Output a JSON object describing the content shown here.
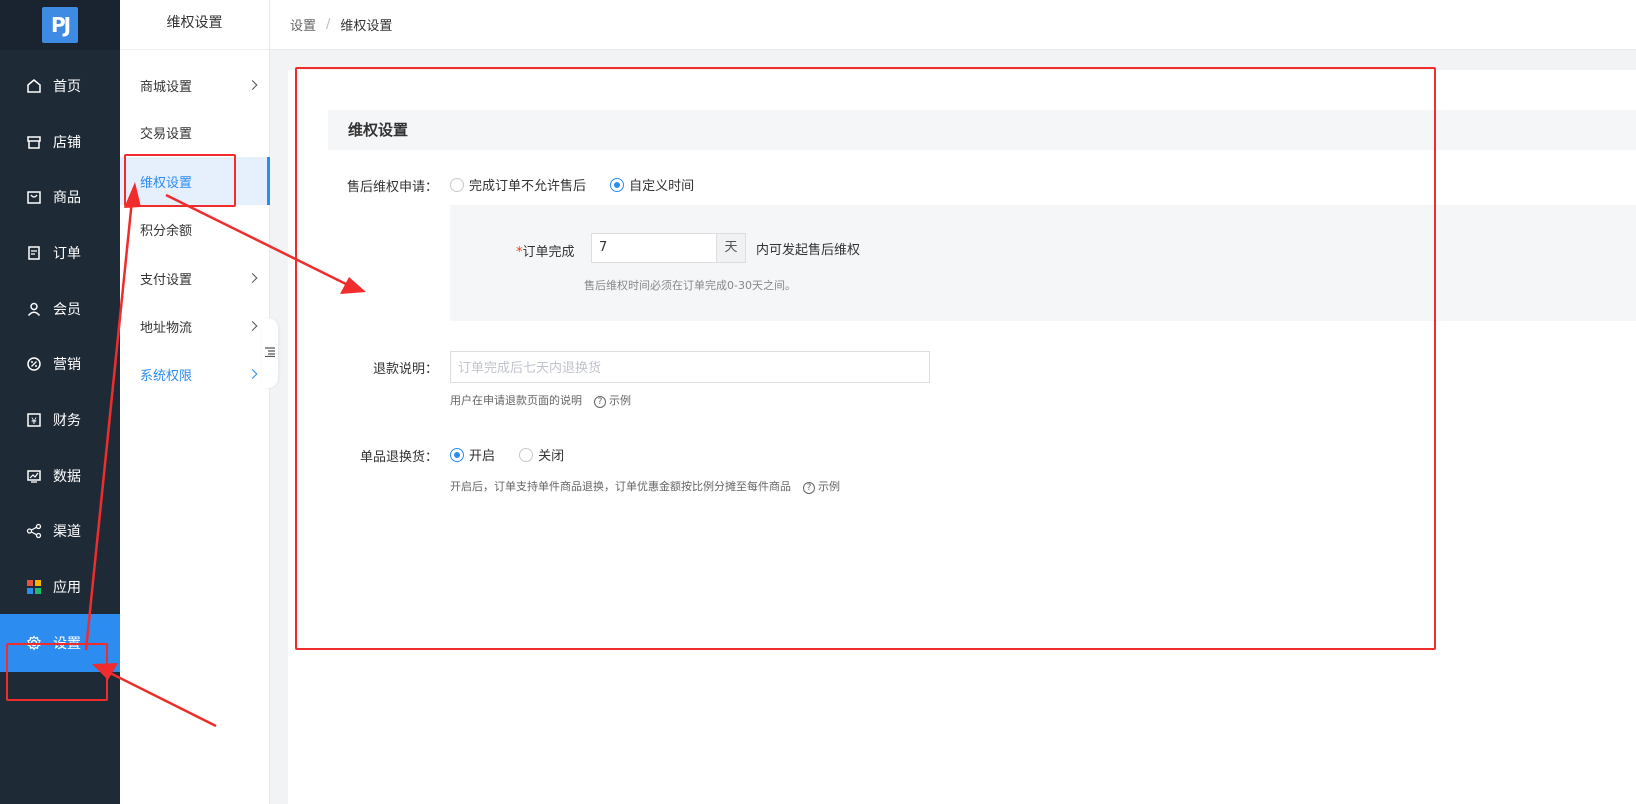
{
  "nav": {
    "logo_text": "PJ",
    "items": [
      {
        "label": "首页",
        "icon": "home-icon"
      },
      {
        "label": "店铺",
        "icon": "store-icon"
      },
      {
        "label": "商品",
        "icon": "bag-icon"
      },
      {
        "label": "订单",
        "icon": "order-icon"
      },
      {
        "label": "会员",
        "icon": "user-icon"
      },
      {
        "label": "营销",
        "icon": "marketing-icon"
      },
      {
        "label": "财务",
        "icon": "yen-icon"
      },
      {
        "label": "数据",
        "icon": "chart-icon"
      },
      {
        "label": "渠道",
        "icon": "share-icon"
      },
      {
        "label": "应用",
        "icon": "apps-icon"
      },
      {
        "label": "设置",
        "icon": "gear-icon"
      }
    ]
  },
  "subnav": {
    "title": "维权设置",
    "items": [
      {
        "label": "商城设置"
      },
      {
        "label": "交易设置"
      },
      {
        "label": "维权设置"
      },
      {
        "label": "积分余额"
      },
      {
        "label": "支付设置"
      },
      {
        "label": "地址物流"
      },
      {
        "label": "系统权限"
      }
    ]
  },
  "breadcrumb": {
    "root": "设置",
    "sep": "/",
    "current": "维权设置"
  },
  "main": {
    "section_title": "维权设置",
    "aftersale": {
      "label": "售后维权申请：",
      "options": [
        "完成订单不允许售后",
        "自定义时间"
      ],
      "selected": "自定义时间"
    },
    "order_complete": {
      "required_mark": "*",
      "label": "订单完成",
      "value": "7",
      "unit": "天",
      "suffix": "内可发起售后维权",
      "hint": "售后维权时间必须在订单完成0-30天之间。"
    },
    "refund": {
      "label": "退款说明：",
      "placeholder": "订单完成后七天内退换货",
      "hint": "用户在申请退款页面的说明",
      "example": "示例"
    },
    "single_return": {
      "label": "单品退换货：",
      "options": [
        "开启",
        "关闭"
      ],
      "selected": "开启",
      "hint": "开启后，订单支持单件商品退换，订单优惠金额按比例分摊至每件商品",
      "example": "示例"
    }
  },
  "colors": {
    "accent": "#2d8cf0",
    "nav_bg": "#1f2a37",
    "annotation": "#f02c2c"
  }
}
